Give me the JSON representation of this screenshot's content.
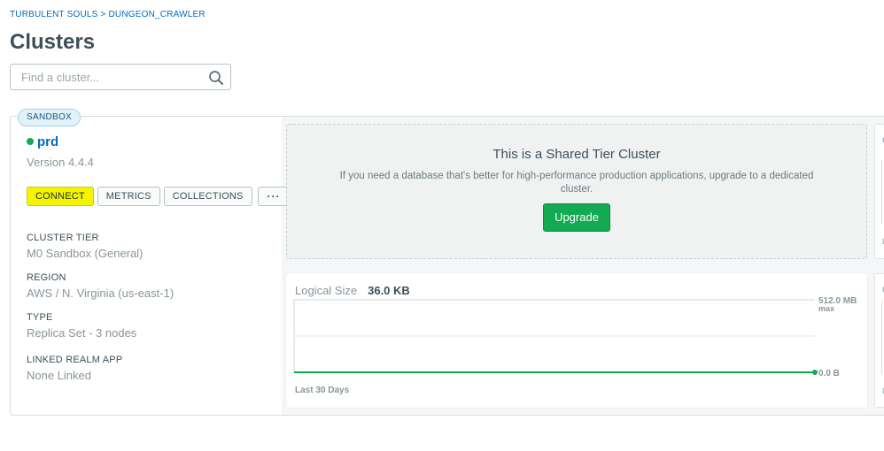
{
  "breadcrumb": {
    "org": "TURBULENT SOULS",
    "separator": " > ",
    "project": "DUNGEON_CRAWLER"
  },
  "page": {
    "title": "Clusters"
  },
  "search": {
    "placeholder": "Find a cluster..."
  },
  "cluster": {
    "badge": "SANDBOX",
    "name": "prd",
    "status_color": "#13aa52",
    "version": "Version 4.4.4",
    "buttons": {
      "connect": "CONNECT",
      "metrics": "METRICS",
      "collections": "COLLECTIONS",
      "more": "···"
    },
    "details": [
      {
        "label": "CLUSTER TIER",
        "value": "M0 Sandbox (General)"
      },
      {
        "label": "REGION",
        "value": "AWS / N. Virginia (us-east-1)"
      },
      {
        "label": "TYPE",
        "value": "Replica Set - 3 nodes"
      },
      {
        "label": "LINKED REALM APP",
        "value": "None Linked"
      }
    ]
  },
  "shared_tier": {
    "title": "This is a Shared Tier Cluster",
    "description": "If you need a database that's better for high-performance production applications, upgrade to a dedicated cluster.",
    "upgrade_label": "Upgrade"
  },
  "logical_size": {
    "label": "Logical Size",
    "value": "36.0 KB",
    "max_label": "512.0 MB",
    "max_sub": "max",
    "min_label": "0.0 B",
    "footer": "Last 30 Days",
    "line_color": "#13aa52"
  },
  "side_cards": {
    "top_char": "C",
    "bottom_char": "L"
  },
  "colors": {
    "accent_link": "#006cbc",
    "connect_highlight": "#f4f400",
    "upgrade_green": "#13aa52"
  }
}
